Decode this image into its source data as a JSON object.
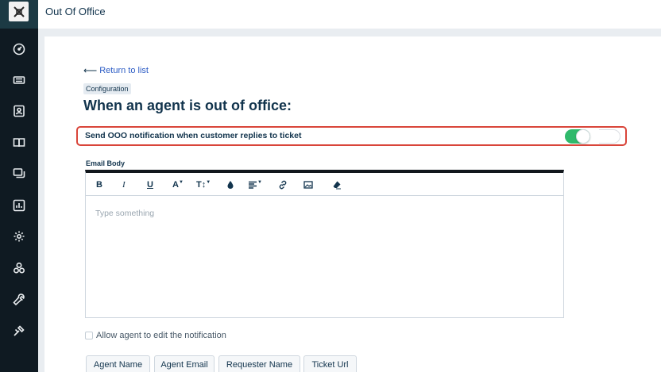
{
  "app": {
    "title": "Out Of Office"
  },
  "sidebar": {
    "logo": "logo-icon",
    "items": [
      {
        "icon": "dashboard-icon"
      },
      {
        "icon": "tickets-icon"
      },
      {
        "icon": "contacts-icon"
      },
      {
        "icon": "knowledge-base-icon"
      },
      {
        "icon": "conversations-icon"
      },
      {
        "icon": "reports-icon"
      },
      {
        "icon": "settings-icon"
      },
      {
        "icon": "groups-icon"
      },
      {
        "icon": "tools-icon"
      },
      {
        "icon": "admin-icon"
      }
    ]
  },
  "page": {
    "back_label": "Return to list",
    "badge": "Configuration",
    "heading": "When an agent is out of office:",
    "toggle_label": "Send OOO notification when customer replies to ticket",
    "toggle_on": true,
    "email_body_label": "Email Body",
    "editor_placeholder": "Type something",
    "allow_edit_label": "Allow agent to edit the notification",
    "allow_edit_checked": false,
    "placeholders": [
      "Agent Name",
      "Agent Email",
      "Requester Name",
      "Ticket Url"
    ]
  },
  "toolbar": {
    "bold": "B",
    "italic": "I",
    "underline": "U",
    "font_size": "A",
    "text_height": "T↕"
  },
  "colors": {
    "accent": "#2c5cc5",
    "toggle_on": "#2fb96b",
    "highlight": "#d9453a",
    "sidebar": "#0f1a22"
  }
}
